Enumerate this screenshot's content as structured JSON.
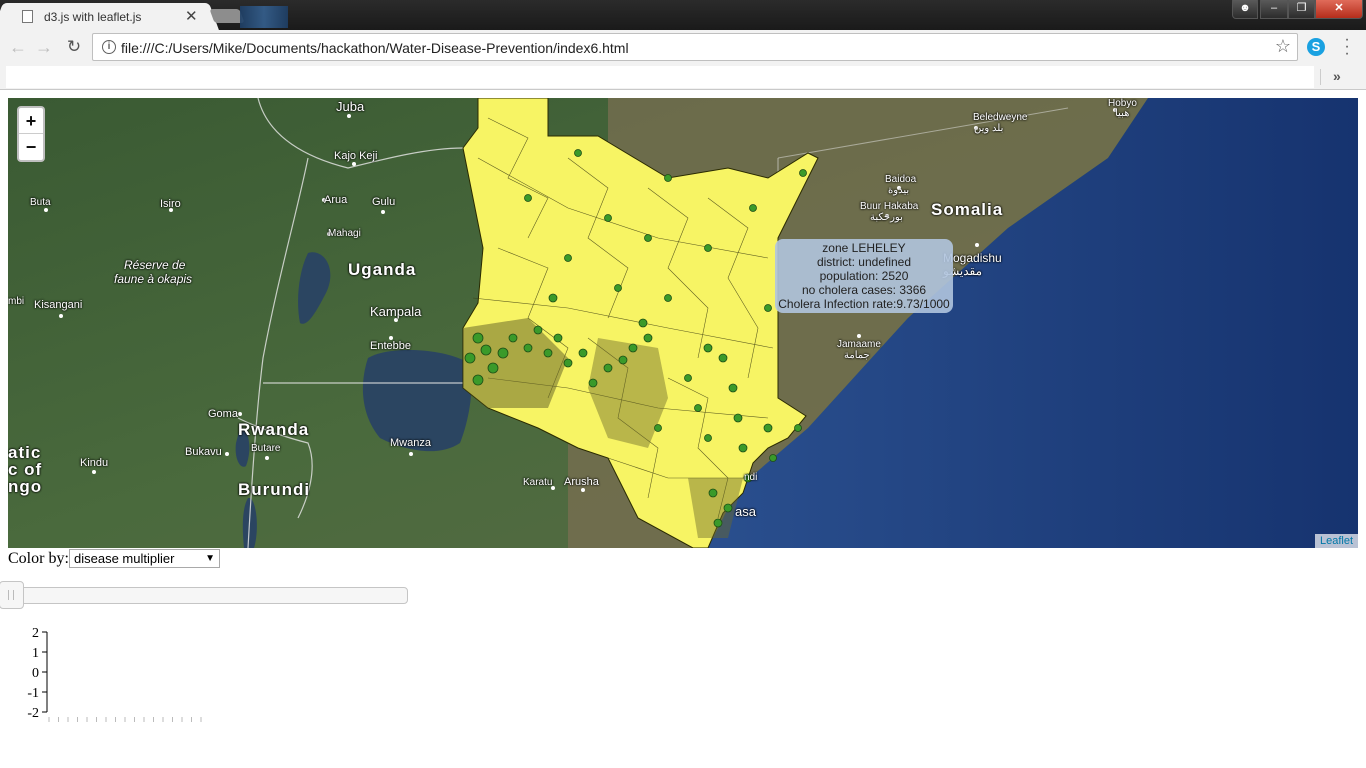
{
  "browser": {
    "tab_title": "d3.js with leaflet.js",
    "tab_close": "✕",
    "url": "file:///C:/Users/Mike/Documents/hackathon/Water-Disease-Prevention/index6.html",
    "bookmarks_chevron": "»"
  },
  "map": {
    "zoom_in": "+",
    "zoom_out": "−",
    "attribution": "Leaflet",
    "labels": {
      "juba": "Juba",
      "kajo_keji": "Kajo Keji",
      "arua": "Arua",
      "gulu": "Gulu",
      "mahagi": "Mahagi",
      "buta": "Buta",
      "isiro": "Isiro",
      "reserve_line1": "Réserve de",
      "reserve_line2": "faune à okapis",
      "uganda": "Uganda",
      "mbi": "mbi",
      "kisangani": "Kisangani",
      "kampala": "Kampala",
      "entebbe": "Entebbe",
      "goma": "Goma",
      "rwanda": "Rwanda",
      "butare": "Butare",
      "bukavu": "Bukavu",
      "kindu": "Kindu",
      "mwanza": "Mwanza",
      "burundi": "Burundi",
      "atic": "atic",
      "c_of": "c of",
      "ngo": "ngo",
      "karatu": "Karatu",
      "arusha": "Arusha",
      "ndi": "ndi",
      "asa": "asa",
      "beledweyne": "Beledweyne",
      "beledweyne_ar": "بلد وين",
      "hobyo": "Hobyo",
      "hobyo_ar": "هبيا",
      "baidoa": "Baidoa",
      "baidoa_ar": "بيدوة",
      "buur_hakaba": "Buur Hakaba",
      "buur_hakaba_ar": "بورحكبة",
      "somalia": "Somalia",
      "mogadishu": "Mogadishu",
      "mogadishu_ar": "مقديشو",
      "jamaame": "Jamaame",
      "jamaame_ar": "جمامة"
    },
    "tooltip": {
      "line1": "zone LEHELEY",
      "line2": "district: undefined",
      "line3": "population: 2520",
      "line4": "no cholera cases: 3366",
      "line5": "Cholera Infection rate:9.73/1000"
    },
    "colors": {
      "region_fill": "#f7f464",
      "marker_fill": "#3a9a2a",
      "ocean": "#1c3f86",
      "land": "#3e5c37"
    }
  },
  "controls": {
    "color_by_label": "Color by:",
    "color_by_value": "disease multiplier",
    "select_arrow": "▼",
    "slider_value": 0
  },
  "chart_data": {
    "type": "line",
    "title": "",
    "xlabel": "",
    "ylabel": "",
    "ylim": [
      -2,
      2
    ],
    "y_ticks": [
      "2",
      "1",
      "0",
      "-1",
      "-2"
    ],
    "series": []
  }
}
